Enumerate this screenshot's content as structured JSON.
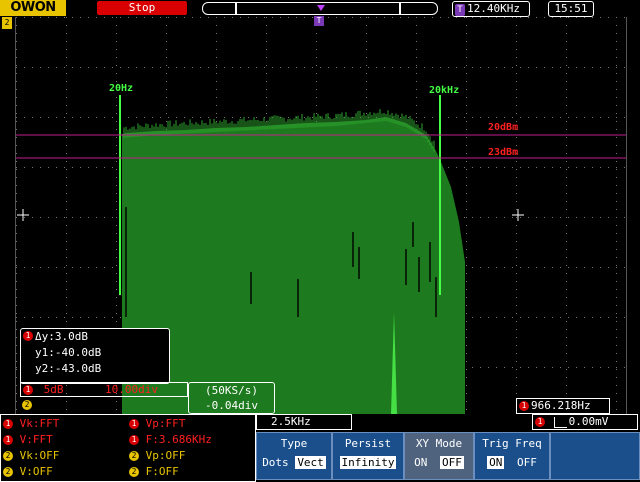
{
  "header": {
    "logo": "OWON",
    "run_state": "Stop",
    "trigger_freq": "12.40KHz",
    "clock": "15:51"
  },
  "waveform": {
    "markers": {
      "left": "20Hz",
      "right": "20kHz",
      "ref1": "20dBm",
      "ref2": "23dBm"
    }
  },
  "cursor": {
    "delta": "Δy:3.0dB",
    "y1": "y1:-40.0dB",
    "y2": "y2:-43.0dB"
  },
  "channels": {
    "ch1_num": "1",
    "ch1_scale": "5dB",
    "ch1_div": "10.00div",
    "ch2_num": "2"
  },
  "sample": {
    "rate": "(50KS/s)",
    "offset": "-0.04div"
  },
  "measurements": {
    "r1_left": "Vk:FFT",
    "r1_right": "Vp:FFT",
    "r2_left": "V:FFT",
    "r2_right": "F:3.686KHz",
    "r3_left": "Vk:OFF",
    "r3_right": "Vp:OFF",
    "r4_left": "V:OFF",
    "r4_right": "F:OFF"
  },
  "horizontal": {
    "scale": "2.5KHz"
  },
  "peak": {
    "freq": "966.218Hz"
  },
  "trigger": {
    "level": "0.00mV"
  },
  "menu": {
    "type_title": "Type",
    "type_opt1": "Dots",
    "type_opt2": "Vect",
    "persist_title": "Persist",
    "persist_value": "Infinity",
    "xy_title": "XY Mode",
    "xy_on": "ON",
    "xy_off": "OFF",
    "trig_title": "Trig Freq",
    "trig_on": "ON",
    "trig_off": "OFF"
  },
  "colors": {
    "brand": "#e8c400",
    "stop": "#d80000",
    "trace": "#1e7a1e",
    "marker": "#44ff44",
    "ref_line": "#c0208c",
    "menu": "#1a4f8c"
  }
}
